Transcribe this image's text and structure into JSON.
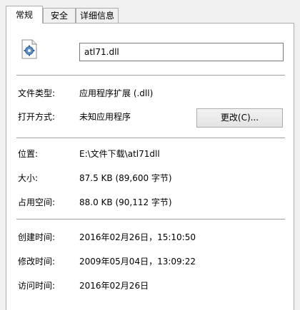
{
  "tabs": [
    {
      "label": "常规",
      "active": true
    },
    {
      "label": "安全",
      "active": false
    },
    {
      "label": "详细信息",
      "active": false
    }
  ],
  "file": {
    "icon": "dll-gear-icon",
    "name": "atl71.dll"
  },
  "type_label": "文件类型:",
  "type_value": "应用程序扩展 (.dll)",
  "opens_with_label": "打开方式:",
  "opens_with_value": "未知应用程序",
  "change_button": "更改(C)...",
  "location_label": "位置:",
  "location_value": "E:\\文件下载\\atl71dll",
  "size_label": "大小:",
  "size_value": "87.5 KB (89,600 字节)",
  "size_on_disk_label": "占用空间:",
  "size_on_disk_value": "88.0 KB (90,112 字节)",
  "created_label": "创建时间:",
  "created_value": "2016年02月26日，15:10:50",
  "modified_label": "修改时间:",
  "modified_value": "2009年05月04日，13:09:22",
  "accessed_label": "访问时间:",
  "accessed_value": "2016年02月26日"
}
